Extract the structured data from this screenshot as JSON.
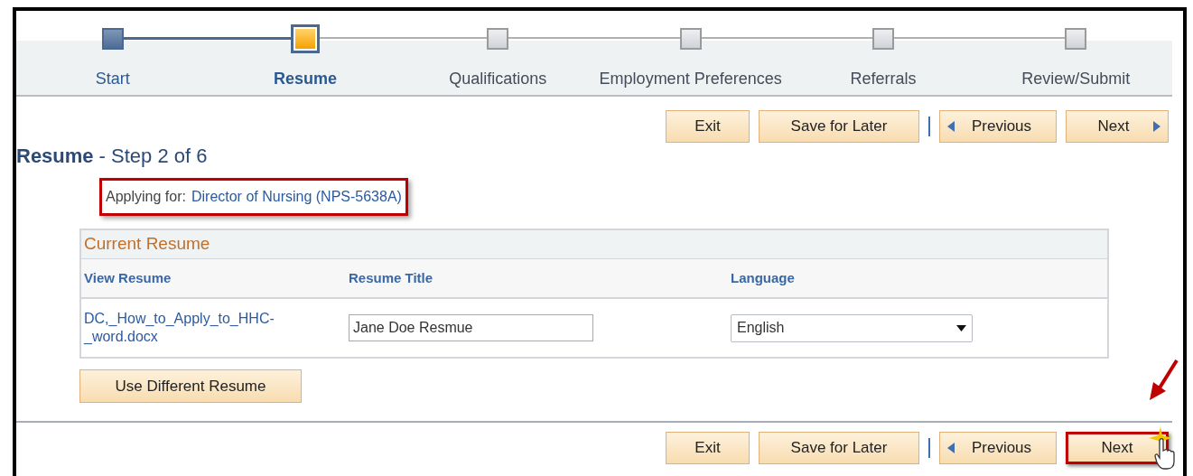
{
  "steps": [
    {
      "label": "Start",
      "completed": true,
      "selected": false
    },
    {
      "label": "Resume",
      "completed": false,
      "selected": true
    },
    {
      "label": "Qualifications",
      "completed": false,
      "selected": false
    },
    {
      "label": "Employment Preferences",
      "completed": false,
      "selected": false
    },
    {
      "label": "Referrals",
      "completed": false,
      "selected": false
    },
    {
      "label": "Review/Submit",
      "completed": false,
      "selected": false
    }
  ],
  "top_buttons": [
    {
      "label": "Exit",
      "kind": "plain",
      "highlighted": false
    },
    {
      "label": "Save for Later",
      "kind": "plain",
      "highlighted": false
    },
    {
      "label": "Previous",
      "kind": "prev",
      "highlighted": false
    },
    {
      "label": "Next",
      "kind": "next",
      "highlighted": false
    }
  ],
  "page_title": "Resume",
  "page_subtitle": "- Step 2 of 6",
  "applying": {
    "label": "Applying for:",
    "job": "Director of Nursing (NPS-5638A)",
    "highlighted": true
  },
  "resume_table": {
    "title": "Current Resume",
    "columns": [
      "View Resume",
      "Resume Title",
      "Language"
    ],
    "rows": [
      {
        "file": "DC,_How_to_Apply_to_HHC-_word.docx",
        "resume_title": "Jane Doe Resmue",
        "language": "English"
      }
    ]
  },
  "use_different_button": "Use Different Resume",
  "bottom_buttons": [
    {
      "label": "Exit",
      "kind": "plain",
      "highlighted": false
    },
    {
      "label": "Save for Later",
      "kind": "plain",
      "highlighted": false
    },
    {
      "label": "Previous",
      "kind": "prev",
      "highlighted": false
    },
    {
      "label": "Next",
      "kind": "next",
      "highlighted": true
    }
  ]
}
